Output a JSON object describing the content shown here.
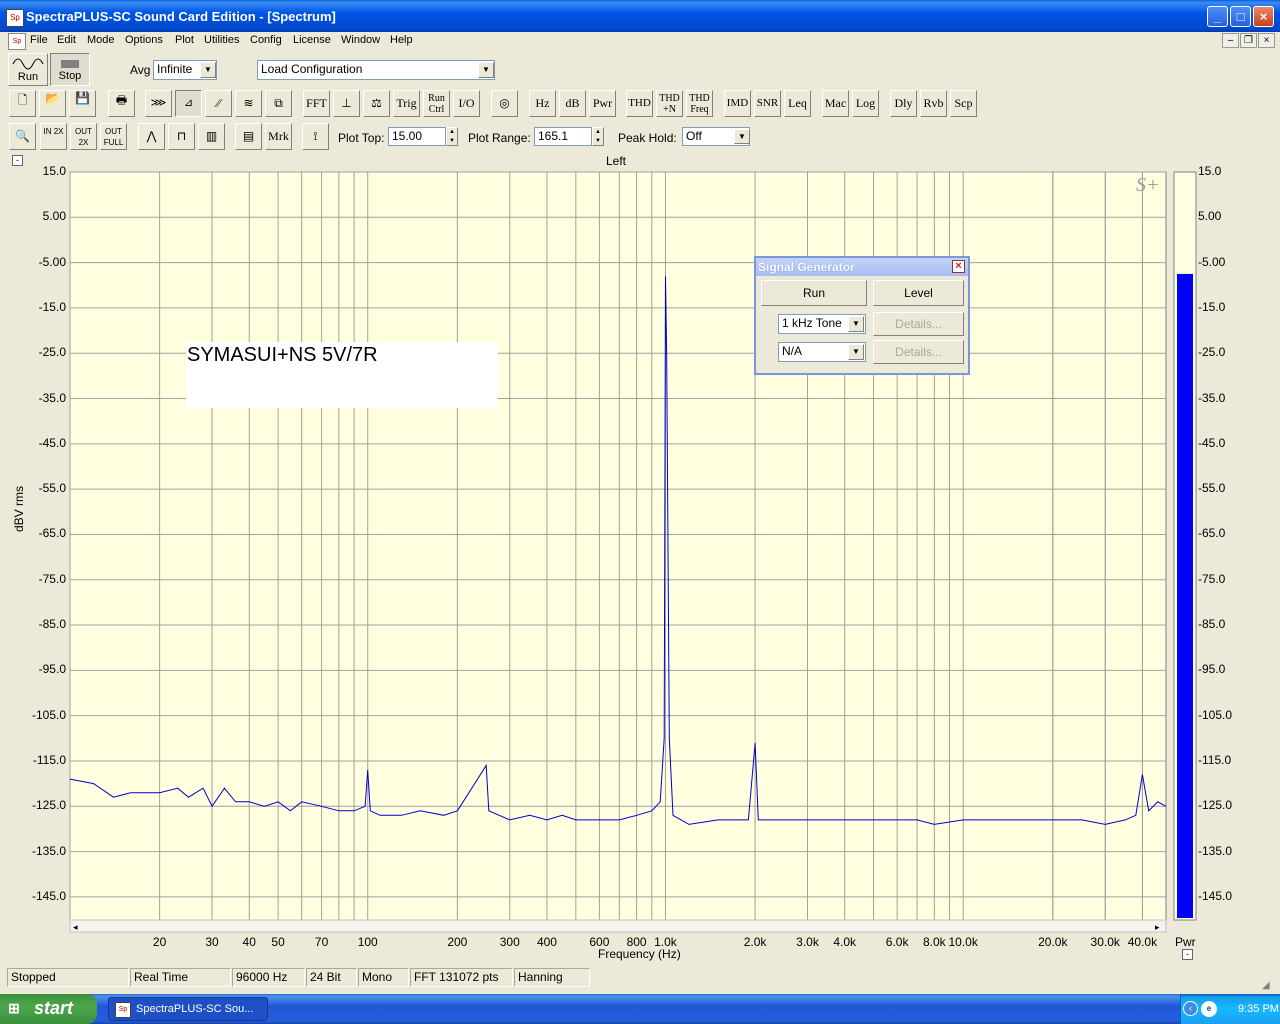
{
  "window": {
    "title": "SpectraPLUS-SC Sound Card Edition - [Spectrum]",
    "icon": "spectraplus-app-icon",
    "controls": {
      "minimize": "_",
      "maximize": "□",
      "close": "×"
    }
  },
  "menubar": {
    "items": [
      "File",
      "Edit",
      "Mode",
      "Options",
      "Plot",
      "Utilities",
      "Config",
      "License",
      "Window",
      "Help"
    ],
    "mdi_controls": {
      "minimize": "–",
      "restore": "❐",
      "close": "×"
    }
  },
  "toolbar_top": {
    "run_label": "Run",
    "stop_label": "Stop",
    "avg_label": "Avg",
    "avg_value": "Infinite",
    "load_config_value": "Load Configuration"
  },
  "toolbar_mid": {
    "buttons": [
      "FFT",
      "Trig",
      "Run Ctrl",
      "I/O",
      "Hz",
      "dB",
      "Pwr",
      "THD",
      "THD +N",
      "THD Freq",
      "IMD",
      "SNR",
      "Leq",
      "Mac",
      "Log",
      "Dly",
      "Rvb",
      "Scp"
    ]
  },
  "toolbar_bottom": {
    "zoom_in": "IN 2X",
    "zoom_out": "OUT 2X",
    "zoom_full": "OUT FULL",
    "marker_label": "Mrk",
    "plot_top_label": "Plot Top:",
    "plot_top_value": "15.00",
    "plot_range_label": "Plot Range:",
    "plot_range_value": "165.1",
    "peak_hold_label": "Peak Hold:",
    "peak_hold_value": "Off"
  },
  "plot": {
    "channel_label": "Left",
    "collapse_symbol": "-",
    "logo_text": "S+",
    "pwr_label": "Pwr",
    "overlay_text": "SYMASUI+NS 5V/7R",
    "line_color": "#0000cc",
    "background_color": "#ffffe0",
    "pwr_bar_color": "#0000ff"
  },
  "chart_data": {
    "type": "line",
    "title": "",
    "xlabel": "Frequency (Hz)",
    "ylabel": "dBV rms",
    "xscale": "log",
    "xlim": [
      10,
      48000
    ],
    "ylim": [
      -150.1,
      15.0
    ],
    "grid": true,
    "y_ticks": [
      "15.0",
      "5.00",
      "-5.00",
      "-15.0",
      "-25.0",
      "-35.0",
      "-45.0",
      "-55.0",
      "-65.0",
      "-75.0",
      "-85.0",
      "-95.0",
      "-105.0",
      "-115.0",
      "-125.0",
      "-135.0",
      "-145.0"
    ],
    "x_ticks": [
      {
        "value": 20,
        "label": "20"
      },
      {
        "value": 30,
        "label": "30"
      },
      {
        "value": 40,
        "label": "40"
      },
      {
        "value": 50,
        "label": "50"
      },
      {
        "value": 70,
        "label": "70"
      },
      {
        "value": 100,
        "label": "100"
      },
      {
        "value": 200,
        "label": "200"
      },
      {
        "value": 300,
        "label": "300"
      },
      {
        "value": 400,
        "label": "400"
      },
      {
        "value": 600,
        "label": "600"
      },
      {
        "value": 800,
        "label": "800"
      },
      {
        "value": 1000,
        "label": "1.0k"
      },
      {
        "value": 2000,
        "label": "2.0k"
      },
      {
        "value": 3000,
        "label": "3.0k"
      },
      {
        "value": 4000,
        "label": "4.0k"
      },
      {
        "value": 6000,
        "label": "6.0k"
      },
      {
        "value": 8000,
        "label": "8.0k"
      },
      {
        "value": 10000,
        "label": "10.0k"
      },
      {
        "value": 20000,
        "label": "20.0k"
      },
      {
        "value": 30000,
        "label": "30.0k"
      },
      {
        "value": 40000,
        "label": "40.0k"
      }
    ],
    "series": [
      {
        "points": [
          [
            10,
            -119
          ],
          [
            12,
            -120
          ],
          [
            14,
            -123
          ],
          [
            16,
            -122
          ],
          [
            18,
            -122
          ],
          [
            20,
            -122
          ],
          [
            23,
            -121
          ],
          [
            25,
            -123
          ],
          [
            28,
            -121
          ],
          [
            30,
            -125
          ],
          [
            33,
            -121
          ],
          [
            36,
            -124
          ],
          [
            40,
            -124
          ],
          [
            45,
            -125
          ],
          [
            50,
            -124
          ],
          [
            55,
            -126
          ],
          [
            60,
            -124
          ],
          [
            70,
            -125
          ],
          [
            80,
            -126
          ],
          [
            90,
            -126
          ],
          [
            98,
            -125
          ],
          [
            100,
            -117
          ],
          [
            102,
            -126
          ],
          [
            110,
            -127
          ],
          [
            130,
            -127
          ],
          [
            150,
            -126
          ],
          [
            180,
            -127
          ],
          [
            200,
            -126
          ],
          [
            250,
            -116
          ],
          [
            255,
            -126
          ],
          [
            300,
            -128
          ],
          [
            350,
            -127
          ],
          [
            400,
            -128
          ],
          [
            450,
            -127
          ],
          [
            500,
            -128
          ],
          [
            600,
            -128
          ],
          [
            700,
            -128
          ],
          [
            800,
            -127
          ],
          [
            900,
            -126
          ],
          [
            960,
            -124
          ],
          [
            990,
            -110
          ],
          [
            1000,
            -8
          ],
          [
            1010,
            -26
          ],
          [
            1030,
            -110
          ],
          [
            1060,
            -127
          ],
          [
            1200,
            -129
          ],
          [
            1500,
            -128
          ],
          [
            1900,
            -128
          ],
          [
            2000,
            -111
          ],
          [
            2050,
            -128
          ],
          [
            2500,
            -128
          ],
          [
            3000,
            -128
          ],
          [
            3500,
            -128
          ],
          [
            4000,
            -128
          ],
          [
            5000,
            -128
          ],
          [
            6000,
            -128
          ],
          [
            7000,
            -128
          ],
          [
            8000,
            -129
          ],
          [
            10000,
            -128
          ],
          [
            12000,
            -128
          ],
          [
            15000,
            -128
          ],
          [
            20000,
            -128
          ],
          [
            25000,
            -128
          ],
          [
            30000,
            -129
          ],
          [
            35000,
            -128
          ],
          [
            38000,
            -127
          ],
          [
            40000,
            -118
          ],
          [
            42000,
            -126
          ],
          [
            45000,
            -124
          ],
          [
            48000,
            -125
          ]
        ]
      }
    ],
    "pwr_level": -7.5
  },
  "signal_generator": {
    "title": "Signal Generator",
    "run_label": "Run",
    "level_label": "Level",
    "waveform_value": "1 kHz Tone",
    "details1_label": "Details...",
    "channel_value": "N/A",
    "details2_label": "Details..."
  },
  "statusbar": {
    "cells": [
      "Stopped",
      "Real Time",
      "96000 Hz",
      "24 Bit",
      "Mono",
      "FFT 131072 pts",
      "Hanning"
    ]
  },
  "taskbar": {
    "start_label": "start",
    "task_label": "SpectraPLUS-SC Sou...",
    "clock": "9:35 PM"
  }
}
